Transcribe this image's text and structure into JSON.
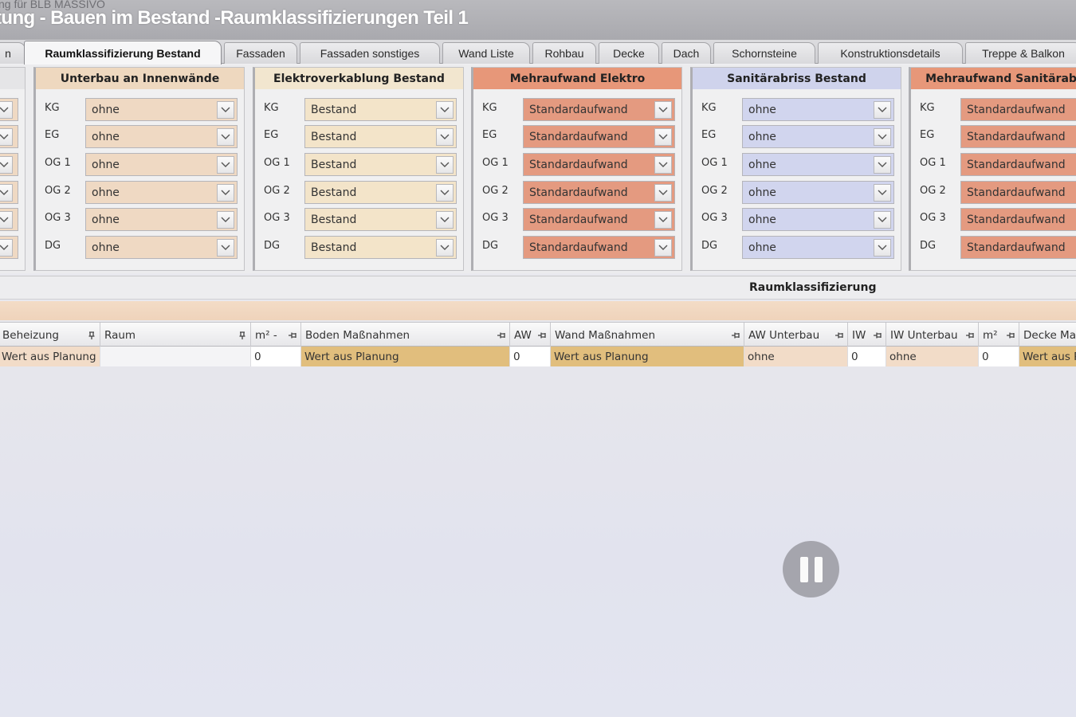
{
  "video": {
    "channel": "ng für BLB MASSIVO",
    "title": "tung - Bauen im Bestand -Raumklassifizierungen Teil 1"
  },
  "tabs": [
    {
      "label": "n",
      "active": false
    },
    {
      "label": "Raumklassifizierung Bestand",
      "active": true
    },
    {
      "label": "Fassaden",
      "active": false
    },
    {
      "label": "Fassaden sonstiges",
      "active": false
    },
    {
      "label": "Wand Liste",
      "active": false
    },
    {
      "label": "Rohbau",
      "active": false
    },
    {
      "label": "Decke",
      "active": false
    },
    {
      "label": "Dach",
      "active": false
    },
    {
      "label": "Schornsteine",
      "active": false
    },
    {
      "label": "Konstruktionsdetails",
      "active": false
    },
    {
      "label": "Treppe & Balkon",
      "active": false
    }
  ],
  "groups": [
    {
      "title": "Unterbau an Innenwände",
      "title_bg": "#eed8bf",
      "field_bg": "#efd9c3",
      "rows": [
        {
          "label": "KG",
          "value": "ohne"
        },
        {
          "label": "EG",
          "value": "ohne"
        },
        {
          "label": "OG 1",
          "value": "ohne"
        },
        {
          "label": "OG 2",
          "value": "ohne"
        },
        {
          "label": "OG 3",
          "value": "ohne"
        },
        {
          "label": "DG",
          "value": "ohne"
        }
      ]
    },
    {
      "title": "Elektroverkablung Bestand",
      "title_bg": "#f2e6cf",
      "field_bg": "#f3e4c9",
      "rows": [
        {
          "label": "KG",
          "value": "Bestand"
        },
        {
          "label": "EG",
          "value": "Bestand"
        },
        {
          "label": "OG 1",
          "value": "Bestand"
        },
        {
          "label": "OG 2",
          "value": "Bestand"
        },
        {
          "label": "OG 3",
          "value": "Bestand"
        },
        {
          "label": "DG",
          "value": "Bestand"
        }
      ]
    },
    {
      "title": "Mehraufwand Elektro",
      "title_bg": "#e79779",
      "field_bg": "#e49a80",
      "rows": [
        {
          "label": "KG",
          "value": "Standardaufwand"
        },
        {
          "label": "EG",
          "value": "Standardaufwand"
        },
        {
          "label": "OG 1",
          "value": "Standardaufwand"
        },
        {
          "label": "OG 2",
          "value": "Standardaufwand"
        },
        {
          "label": "OG 3",
          "value": "Standardaufwand"
        },
        {
          "label": "DG",
          "value": "Standardaufwand"
        }
      ]
    },
    {
      "title": "Sanitärabriss Bestand",
      "title_bg": "#cfd3ec",
      "field_bg": "#d1d5ee",
      "rows": [
        {
          "label": "KG",
          "value": "ohne"
        },
        {
          "label": "EG",
          "value": "ohne"
        },
        {
          "label": "OG 1",
          "value": "ohne"
        },
        {
          "label": "OG 2",
          "value": "ohne"
        },
        {
          "label": "OG 3",
          "value": "ohne"
        },
        {
          "label": "DG",
          "value": "ohne"
        }
      ]
    },
    {
      "title": "Mehraufwand Sanitärab",
      "title_bg": "#e79779",
      "field_bg": "#e49a80",
      "rows": [
        {
          "label": "KG",
          "value": "Standardaufwand"
        },
        {
          "label": "EG",
          "value": "Standardaufwand"
        },
        {
          "label": "OG 1",
          "value": "Standardaufwand"
        },
        {
          "label": "OG 2",
          "value": "Standardaufwand"
        },
        {
          "label": "OG 3",
          "value": "Standardaufwand"
        },
        {
          "label": "DG",
          "value": "Standardaufwand"
        }
      ]
    }
  ],
  "section": {
    "title": "Raumklassifizierung"
  },
  "grid": {
    "columns": [
      {
        "header": "Beheizung",
        "value": "Wert aus Planung",
        "cell_bg": "#f2dcc8"
      },
      {
        "header": "Raum",
        "value": "",
        "cell_bg": "#f4f4f6"
      },
      {
        "header": "m² -",
        "value": "0",
        "cell_bg": "#ffffff"
      },
      {
        "header": "Boden Maßnahmen",
        "value": "Wert aus Planung",
        "cell_bg": "#e1be7d"
      },
      {
        "header": "AW",
        "value": "0",
        "cell_bg": "#ffffff"
      },
      {
        "header": "Wand Maßnahmen",
        "value": "Wert aus Planung",
        "cell_bg": "#e1be7d"
      },
      {
        "header": "AW Unterbau",
        "value": "ohne",
        "cell_bg": "#f2dcc8"
      },
      {
        "header": "IW",
        "value": "0",
        "cell_bg": "#ffffff"
      },
      {
        "header": "IW Unterbau",
        "value": "ohne",
        "cell_bg": "#f2dcc8"
      },
      {
        "header": "m²",
        "value": "0",
        "cell_bg": "#ffffff"
      },
      {
        "header": "Decke Ma",
        "value": "Wert aus P",
        "cell_bg": "#e1be7d"
      }
    ]
  },
  "player": {
    "pause_icon": "pause-icon"
  }
}
